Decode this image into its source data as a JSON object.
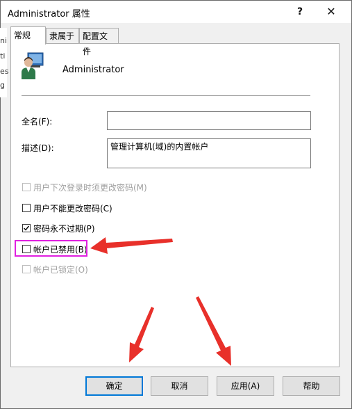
{
  "window": {
    "title": "Administrator 属性",
    "help_glyph": "?",
    "close_glyph": "✕"
  },
  "background_letters": [
    "ni",
    "ti",
    "es",
    "g"
  ],
  "tabs": [
    {
      "label": "常规",
      "active": true
    },
    {
      "label": "隶属于",
      "active": false
    },
    {
      "label": "配置文件",
      "active": false
    }
  ],
  "user": {
    "name": "Administrator"
  },
  "fields": {
    "fullname_label": "全名(F):",
    "fullname_value": "",
    "description_label": "描述(D):",
    "description_value": "管理计算机(域)的内置帐户"
  },
  "options": [
    {
      "label": "用户下次登录时须更改密码(M)",
      "checked": false,
      "enabled": false
    },
    {
      "label": "用户不能更改密码(C)",
      "checked": false,
      "enabled": true
    },
    {
      "label": "密码永不过期(P)",
      "checked": true,
      "enabled": true
    },
    {
      "label": "帐户已禁用(B)",
      "checked": false,
      "enabled": true
    },
    {
      "label": "帐户已锁定(O)",
      "checked": false,
      "enabled": false
    }
  ],
  "buttons": {
    "ok": "确定",
    "cancel": "取消",
    "apply": "应用(A)",
    "help": "帮助"
  },
  "colors": {
    "highlight": "#e020e0",
    "arrow": "#e8302a",
    "default_button_border": "#0078d7"
  }
}
